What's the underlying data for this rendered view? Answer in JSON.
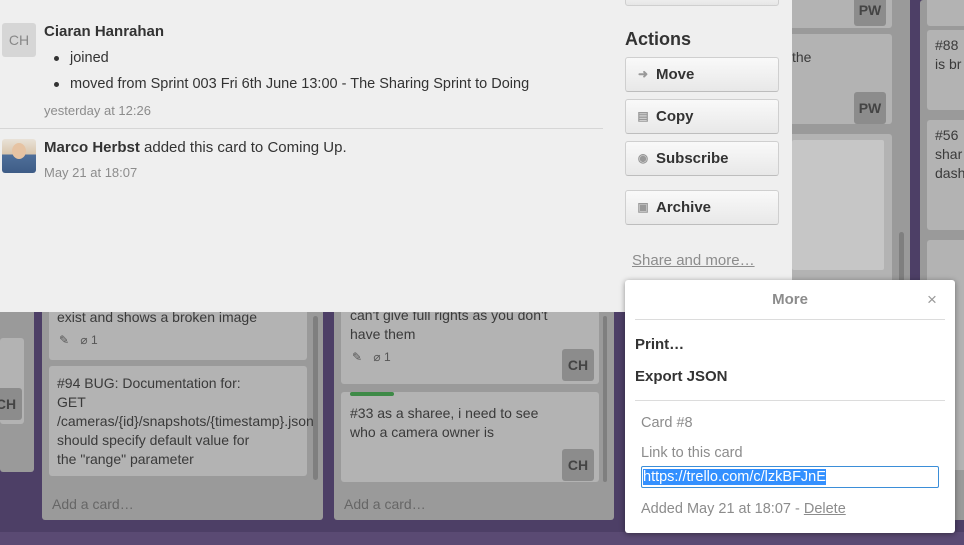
{
  "activity": [
    {
      "initials": "CH",
      "name": "Ciaran Hanrahan",
      "items": [
        "joined",
        "moved from Sprint 003 Fri 6th June 13:00 - The Sharing Sprint to Doing"
      ],
      "time": "yesterday at 12:26"
    },
    {
      "name": "Marco Herbst",
      "action": "added this card to Coming Up.",
      "time": "May 21 at 18:07"
    }
  ],
  "sidebar": {
    "actions_title": "Actions",
    "buttons": {
      "move": "Move",
      "copy": "Copy",
      "subscribe": "Subscribe",
      "archive": "Archive"
    },
    "share_link": "Share and more…"
  },
  "popover": {
    "title": "More",
    "close": "×",
    "print": "Print…",
    "export_json": "Export JSON",
    "card_number": "Card #8",
    "link_label": "Link to this card",
    "link_url": "https://trello.com/c/lzkBFJnE",
    "added": "Added May 21 at 18:07 -",
    "delete": "Delete"
  },
  "board": {
    "cards": {
      "broken_image": "exist and shows a broken image",
      "bug94": "#94 BUG: Documentation for: GET /cameras/{id}/snapshots/{timestamp}.json should specify default value for the \"range\" parameter",
      "rights": "can't give full rights as you don't have them",
      "card33": "#33 as a sharee, i need to see who a camera owner is",
      "right_text": "the",
      "card88": "#88 is br",
      "card56": "#56 shar dash"
    },
    "attachments_count": "1",
    "add_card": "Add a card…",
    "member_ch": "CH",
    "member_pw": "PW"
  }
}
